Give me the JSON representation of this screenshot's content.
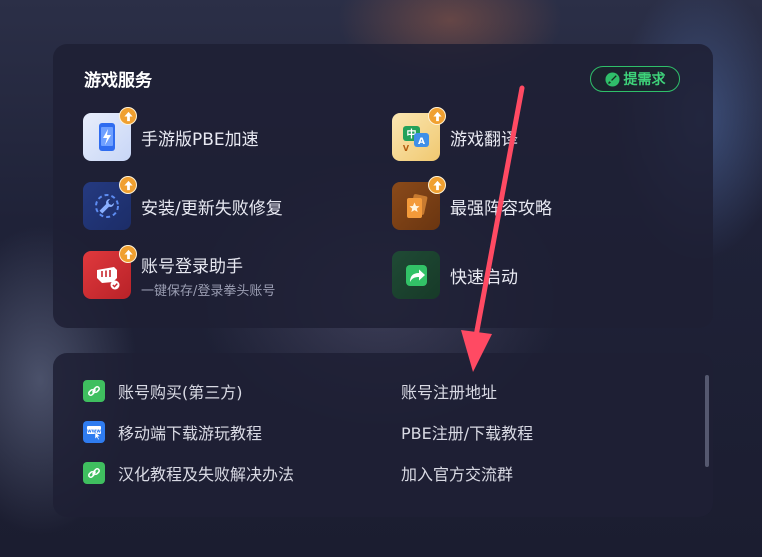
{
  "services": {
    "title": "游戏服务",
    "request_button": "提需求",
    "items": [
      {
        "label": "手游版PBE加速",
        "sub": "",
        "icon": "phone-boost-icon"
      },
      {
        "label": "游戏翻译",
        "sub": "",
        "icon": "translate-icon"
      },
      {
        "label": "安装/更新失败修复",
        "sub": "",
        "icon": "wrench-repair-icon"
      },
      {
        "label": "最强阵容攻略",
        "sub": "",
        "icon": "lineup-guide-icon"
      },
      {
        "label": "账号登录助手",
        "sub": "一键保存/登录拳头账号",
        "icon": "riot-fist-icon"
      },
      {
        "label": "快速启动",
        "sub": "",
        "icon": "quick-launch-icon"
      }
    ]
  },
  "links": {
    "items": [
      {
        "label": "账号购买(第三方)",
        "icon": "link-icon"
      },
      {
        "label": "账号注册地址",
        "icon": ""
      },
      {
        "label": "移动端下载游玩教程",
        "icon": "www-cursor-icon"
      },
      {
        "label": "PBE注册/下载教程",
        "icon": ""
      },
      {
        "label": "汉化教程及失败解决办法",
        "icon": "link-icon"
      },
      {
        "label": "加入官方交流群",
        "icon": ""
      }
    ]
  },
  "colors": {
    "accent_green": "#3ed37a",
    "badge_orange": "#f0a030",
    "arrow_red": "#ff4a63"
  }
}
